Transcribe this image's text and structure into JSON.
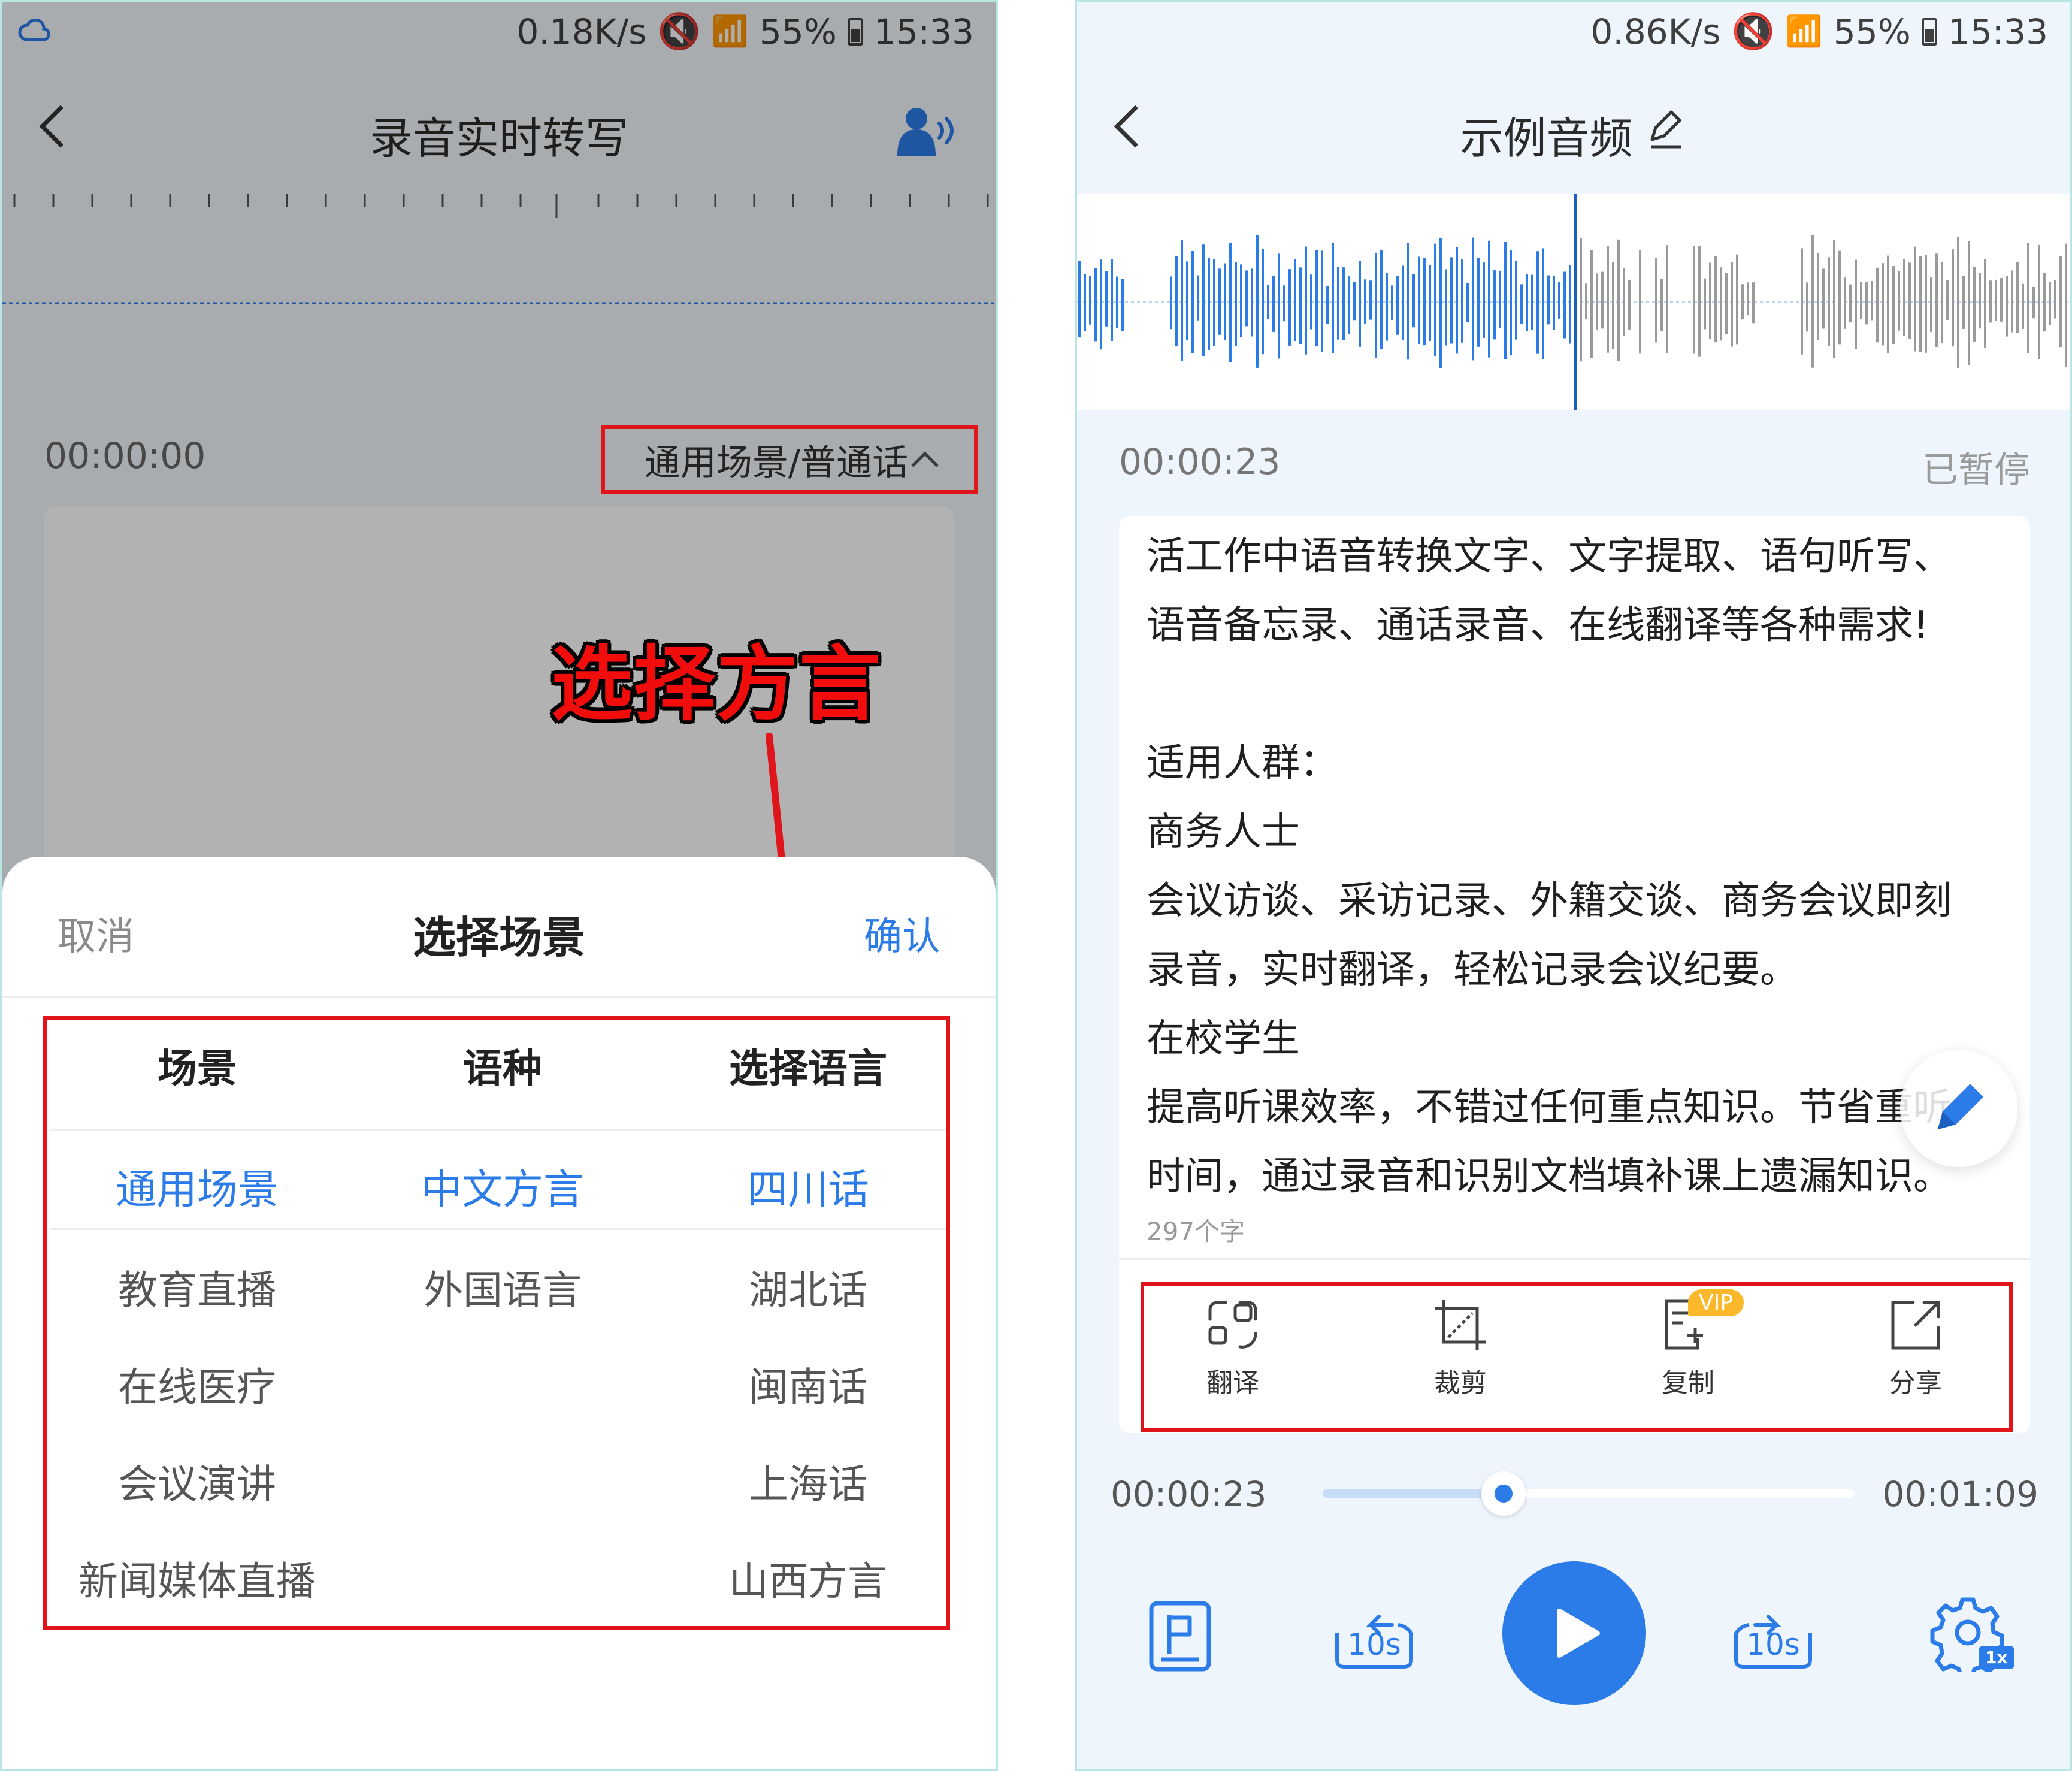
{
  "left": {
    "status_bar": {
      "speed": "0.18K/s",
      "battery": "55%",
      "time": "15:33"
    },
    "title": "录音实时转写",
    "timer": "00:00:00",
    "scene_selector": "通用场景/普通话",
    "callout": "选择方言",
    "sheet": {
      "cancel": "取消",
      "title": "选择场景",
      "confirm": "确认",
      "headers": [
        "场景",
        "语种",
        "选择语言"
      ],
      "scenes": [
        "通用场景",
        "教育直播",
        "在线医疗",
        "会议演讲",
        "新闻媒体直播"
      ],
      "languages": [
        "中文方言",
        "外国语言"
      ],
      "dialects": [
        "四川话",
        "湖北话",
        "闽南话",
        "上海话",
        "山西方言"
      ]
    }
  },
  "right": {
    "status_bar": {
      "speed": "0.86K/s",
      "battery": "55%",
      "time": "15:33"
    },
    "title": "示例音频",
    "timer": "00:00:23",
    "status": "已暂停",
    "transcript": [
      "活工作中语音转换文字、文字提取、语句听写、",
      "语音备忘录、通话录音、在线翻译等各种需求!",
      "",
      "适用人群：",
      "商务人士",
      "会议访谈、采访记录、外籍交谈、商务会议即刻",
      "录音，实时翻译，轻松记录会议纪要。",
      "在校学生",
      "提高听课效率，不错过任何重点知识。节省重听",
      "时间，通过录音和识别文档填补课上遗漏知识。"
    ],
    "char_count": "297个字",
    "tools": {
      "translate": "翻译",
      "crop": "裁剪",
      "copy": "复制",
      "share": "分享",
      "vip": "VIP"
    },
    "player": {
      "current": "00:00:23",
      "total": "00:01:09",
      "progress": 0.34,
      "skip_back": "10s",
      "skip_fwd": "10s",
      "speed": "1x"
    }
  },
  "colors": {
    "accent": "#2b7ce9",
    "highlight_red": "#e0141b",
    "overlay": "rgba(0,0,0,0.3)"
  }
}
